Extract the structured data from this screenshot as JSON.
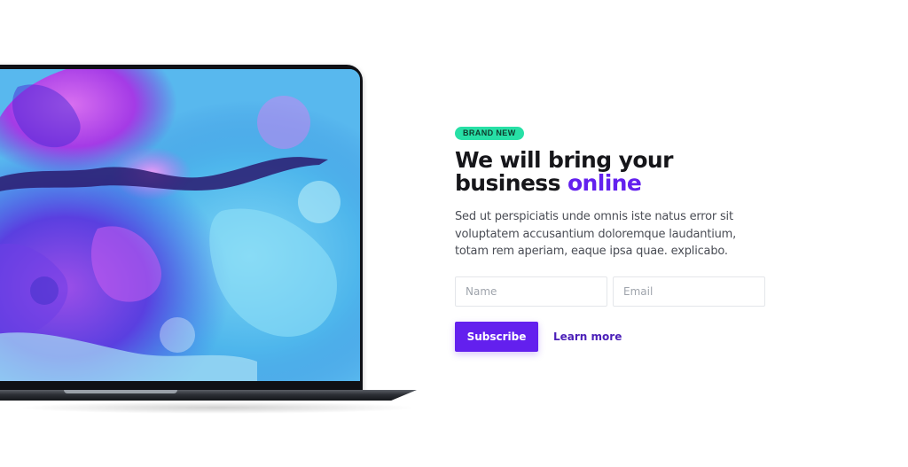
{
  "hero": {
    "badge": "BRAND NEW",
    "title_line1": "We will bring your",
    "title_line2_prefix": "business ",
    "title_line2_accent": "online",
    "description_lines": [
      "Sed ut perspiciatis unde omnis iste natus error sit",
      "voluptatem accusantium doloremque laudantium,",
      "totam rem aperiam, eaque ipsa quae. explicabo."
    ]
  },
  "form": {
    "name_placeholder": "Name",
    "name_value": "",
    "email_placeholder": "Email",
    "email_value": ""
  },
  "actions": {
    "subscribe_label": "Subscribe",
    "learn_more_label": "Learn more"
  },
  "colors": {
    "accent": "#6320ee",
    "badge": "#27e0a6",
    "title": "#16161a",
    "body_text": "#4a4d55"
  },
  "icons": {
    "laptop_mockup": "laptop-image"
  }
}
